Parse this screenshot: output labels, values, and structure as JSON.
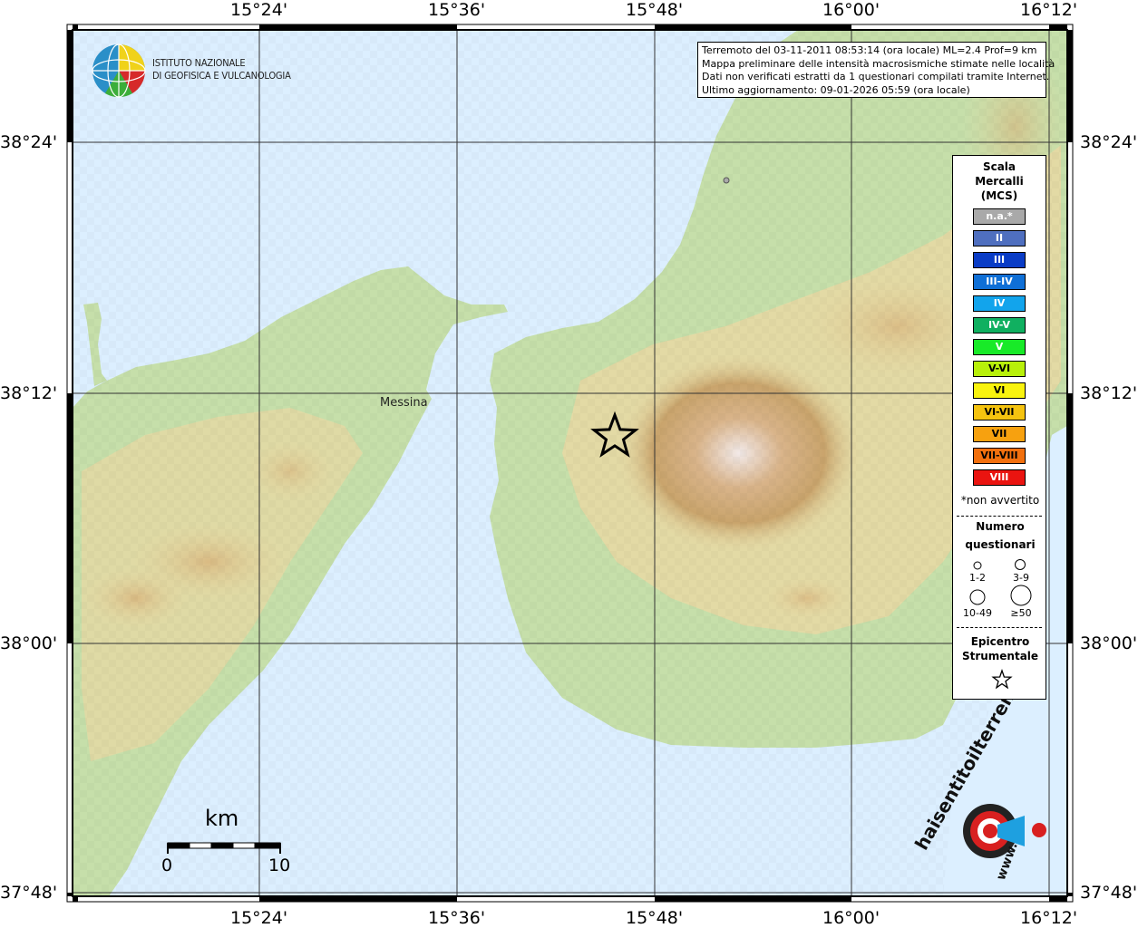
{
  "map": {
    "longitude_labels": [
      "15°24'",
      "15°36'",
      "15°48'",
      "16°00'",
      "16°12'"
    ],
    "latitude_labels": [
      "38°24'",
      "38°12'",
      "38°00'",
      "37°48'"
    ],
    "place": "Messina",
    "colors": {
      "sea": "#dcefff",
      "land_low": "#bcd9a6",
      "land_mid": "#e8dca6",
      "land_high": "#c59a62",
      "peak": "#eee2dc"
    }
  },
  "logo": {
    "line1": "ISTITUTO NAZIONALE",
    "line2": "DI GEOFISICA E VULCANOLOGIA"
  },
  "info": {
    "line1": "Terremoto del 03-11-2011 08:53:14 (ora locale) ML=2.4 Prof=9 km",
    "line2": "Mappa preliminare delle intensità macrosismiche stimate nelle località",
    "line3": "Dati non verificati estratti da 1 questionari compilati tramite Internet.",
    "line4": "Ultimo aggiornamento: 09-01-2026 05:59 (ora locale)"
  },
  "legend": {
    "title_line1": "Scala",
    "title_line2": "Mercalli",
    "title_line3": "(MCS)",
    "scale": [
      {
        "label": "n.a.*",
        "color": "#a9a9a9"
      },
      {
        "label": "II",
        "color": "#4f6fbf"
      },
      {
        "label": "III",
        "color": "#0a3cc6"
      },
      {
        "label": "III-IV",
        "color": "#0f6fd6"
      },
      {
        "label": "IV",
        "color": "#12a4ec"
      },
      {
        "label": "IV-V",
        "color": "#10b060"
      },
      {
        "label": "V",
        "color": "#18ea28"
      },
      {
        "label": "V-VI",
        "color": "#b8f00a"
      },
      {
        "label": "VI",
        "color": "#f9f30e"
      },
      {
        "label": "VI-VII",
        "color": "#f5c30f"
      },
      {
        "label": "VII",
        "color": "#f7a10f"
      },
      {
        "label": "VII-VIII",
        "color": "#f2700e"
      },
      {
        "label": "VIII",
        "color": "#ea1410"
      }
    ],
    "note": "*non avvertito",
    "count_title_line1": "Numero",
    "count_title_line2": "questionari",
    "counts": [
      "1-2",
      "3-9",
      "10-49",
      "≥50"
    ],
    "epicenter_line1": "Epicentro",
    "epicenter_line2": "Strumentale"
  },
  "scalebar": {
    "unit": "km",
    "start": "0",
    "end": "10"
  },
  "brand": {
    "text": "haisentitoilterremoto.it",
    "url": "www."
  }
}
